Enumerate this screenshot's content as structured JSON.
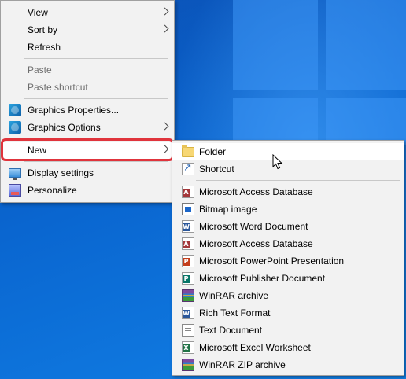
{
  "context_menu": {
    "items": [
      {
        "label": "View",
        "submenu": true
      },
      {
        "label": "Sort by",
        "submenu": true
      },
      {
        "label": "Refresh"
      },
      {
        "label": "Paste",
        "disabled": true
      },
      {
        "label": "Paste shortcut",
        "disabled": true
      },
      {
        "label": "Graphics Properties...",
        "icon": "graphics-icon"
      },
      {
        "label": "Graphics Options",
        "icon": "graphics-icon",
        "submenu": true
      },
      {
        "label": "New",
        "submenu": true,
        "highlighted": true
      },
      {
        "label": "Display settings",
        "icon": "display-icon"
      },
      {
        "label": "Personalize",
        "icon": "personalize-icon"
      }
    ]
  },
  "new_submenu": {
    "items": [
      {
        "label": "Folder",
        "icon": "folder-icon"
      },
      {
        "label": "Shortcut",
        "icon": "shortcut-icon"
      },
      {
        "label": "Microsoft Access Database",
        "icon": "access-icon"
      },
      {
        "label": "Bitmap image",
        "icon": "bitmap-icon"
      },
      {
        "label": "Microsoft Word Document",
        "icon": "word-icon"
      },
      {
        "label": "Microsoft Access Database",
        "icon": "access-icon"
      },
      {
        "label": "Microsoft PowerPoint Presentation",
        "icon": "powerpoint-icon"
      },
      {
        "label": "Microsoft Publisher Document",
        "icon": "publisher-icon"
      },
      {
        "label": "WinRAR archive",
        "icon": "winrar-icon"
      },
      {
        "label": "Rich Text Format",
        "icon": "word-icon"
      },
      {
        "label": "Text Document",
        "icon": "text-icon"
      },
      {
        "label": "Microsoft Excel Worksheet",
        "icon": "excel-icon"
      },
      {
        "label": "WinRAR ZIP archive",
        "icon": "winrar-icon"
      }
    ]
  },
  "icon_badges": {
    "access": "A",
    "word": "W",
    "powerpoint": "P",
    "publisher": "P",
    "excel": "X"
  },
  "colors": {
    "highlight_border": "#e0343c",
    "menu_bg": "#f2f2f2",
    "desktop": "#0a66d0"
  }
}
